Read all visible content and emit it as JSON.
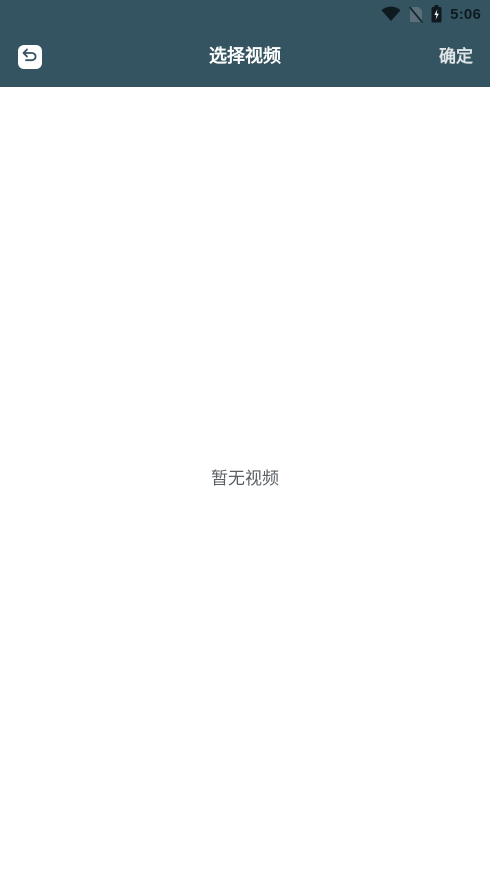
{
  "status_bar": {
    "time": "5:06",
    "icons": [
      "wifi-icon",
      "no-sim-icon",
      "battery-icon"
    ]
  },
  "header": {
    "back_icon": "back-icon",
    "title": "选择视频",
    "confirm_label": "确定"
  },
  "main": {
    "empty_message": "暂无视频"
  },
  "colors": {
    "header_bg": "#355461",
    "content_bg": "#ffffff",
    "empty_text": "#5a5f64"
  }
}
